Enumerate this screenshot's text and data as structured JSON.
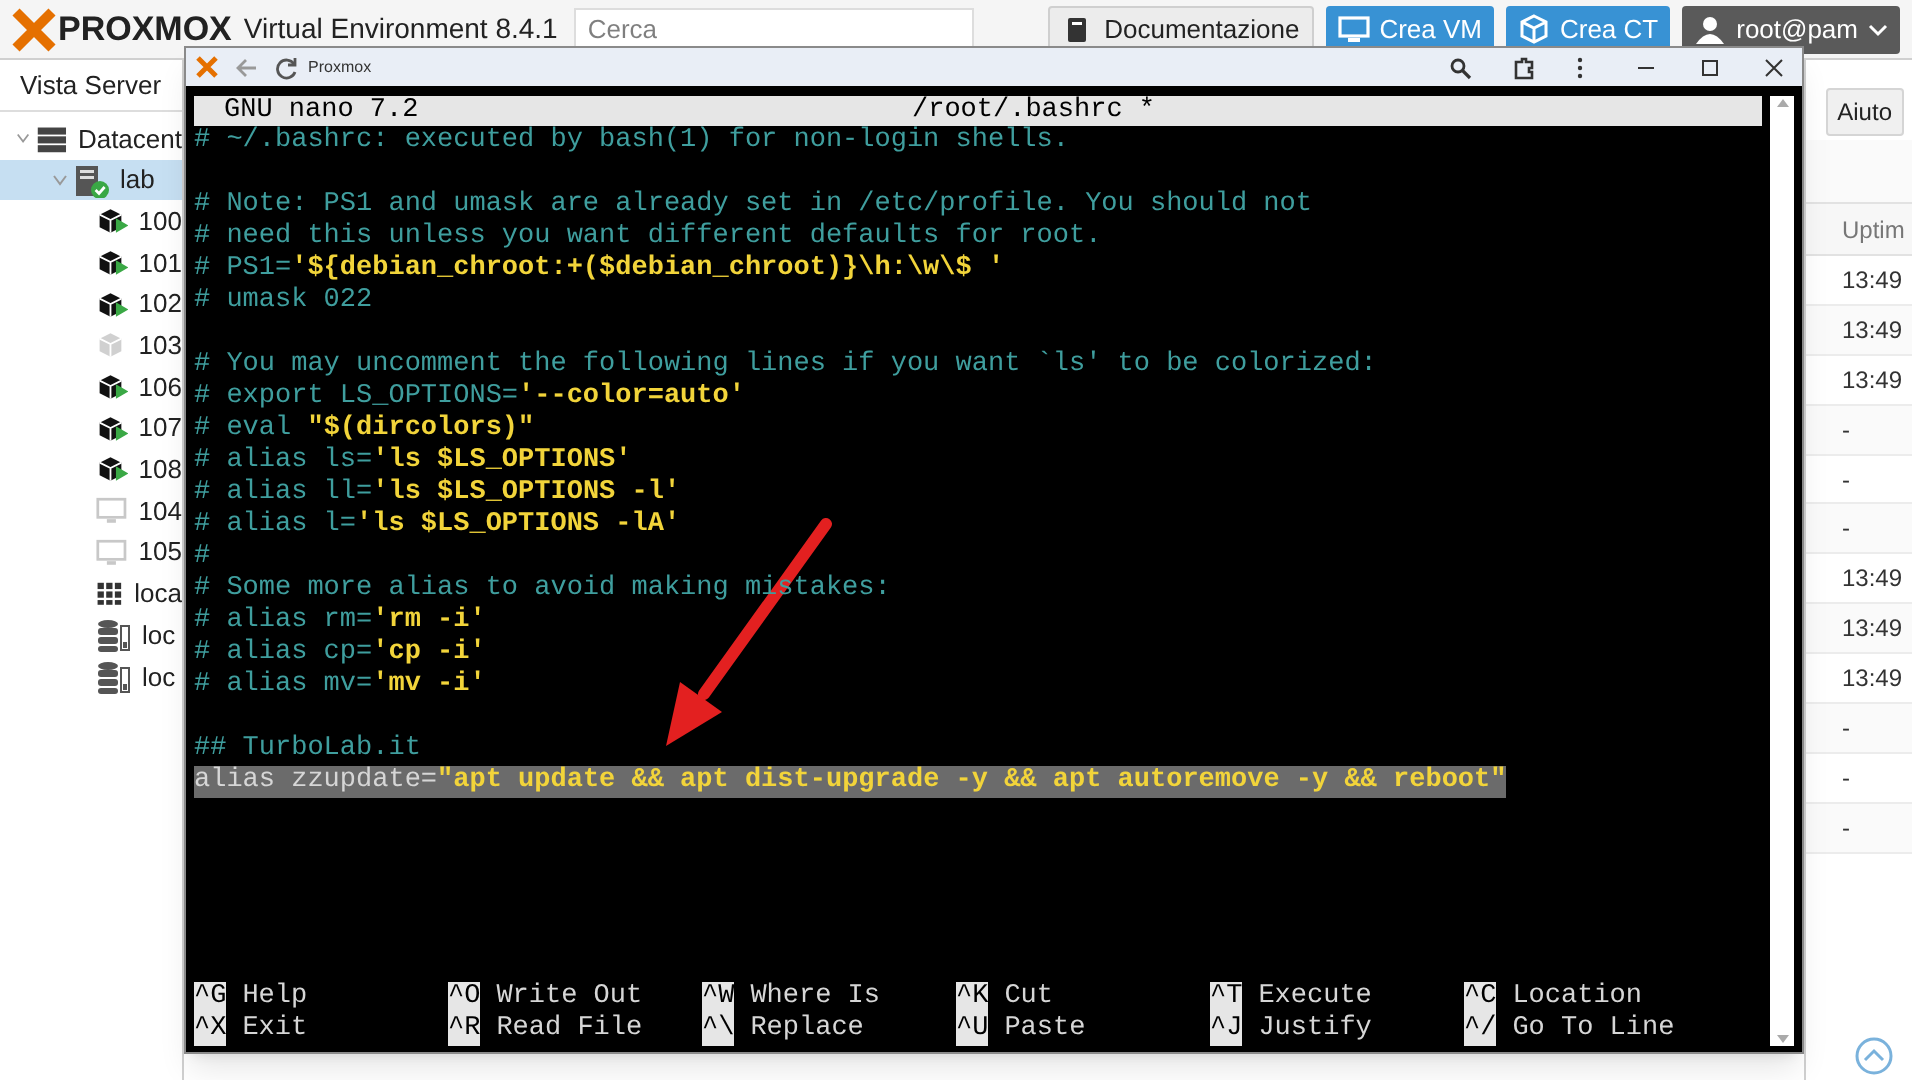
{
  "topbar": {
    "logo": "PROXMOX",
    "product": "Virtual Environment 8.4.1",
    "search": {
      "placeholder": "Cerca"
    },
    "buttons": [
      {
        "label": "Documentazione",
        "kind": "docs"
      },
      {
        "label": "Crea VM",
        "kind": "vm"
      },
      {
        "label": "Crea CT",
        "kind": "ct"
      },
      {
        "label": "root@pam",
        "kind": "user"
      }
    ]
  },
  "sidebar": {
    "view": "Vista Server",
    "tree": [
      {
        "label": "Datacent",
        "kind": "datacenter",
        "expanded": true,
        "selected": false,
        "children": [
          {
            "label": "lab",
            "kind": "node",
            "expanded": true,
            "selected": true,
            "children": [
              {
                "label": "100",
                "kind": "vm",
                "running": true,
                "selected": false
              },
              {
                "label": "101",
                "kind": "vm",
                "running": true,
                "selected": false
              },
              {
                "label": "102",
                "kind": "vm",
                "running": true,
                "selected": false
              },
              {
                "label": "103",
                "kind": "vm",
                "running": false,
                "selected": false
              },
              {
                "label": "106",
                "kind": "vm",
                "running": true,
                "selected": false
              },
              {
                "label": "107",
                "kind": "vm",
                "running": true,
                "selected": false
              },
              {
                "label": "108",
                "kind": "vm",
                "running": true,
                "selected": false
              },
              {
                "label": "104",
                "kind": "template",
                "selected": false
              },
              {
                "label": "105",
                "kind": "template",
                "selected": false
              },
              {
                "label": "loca",
                "kind": "pool",
                "selected": false
              },
              {
                "label": "loc",
                "kind": "storage",
                "selected": false
              },
              {
                "label": "loc",
                "kind": "storage",
                "selected": false
              }
            ]
          }
        ]
      }
    ]
  },
  "right_panel": {
    "help_button": "Aiuto",
    "table": {
      "columns": [
        "Uptim"
      ],
      "rows": [
        {
          "cells": [
            "13:49"
          ]
        },
        {
          "cells": [
            "13:49"
          ]
        },
        {
          "cells": [
            "13:49"
          ]
        },
        {
          "cells": [
            "-"
          ]
        },
        {
          "cells": [
            "-"
          ]
        },
        {
          "cells": [
            "-"
          ]
        },
        {
          "cells": [
            "13:49"
          ]
        },
        {
          "cells": [
            "13:49"
          ]
        },
        {
          "cells": [
            "13:49"
          ]
        },
        {
          "cells": [
            "-"
          ]
        },
        {
          "cells": [
            "-"
          ]
        },
        {
          "cells": [
            "-"
          ]
        }
      ]
    }
  },
  "popup": {
    "title": "Proxmox",
    "editor": {
      "name": "GNU nano 7.2",
      "file": "/root/.bashrc *",
      "lines": [
        {
          "kind": "text",
          "segments": [
            {
              "kind": "comment",
              "text": "# ~/.bashrc: executed by bash(1) for non-login shells."
            }
          ]
        },
        {
          "kind": "blank"
        },
        {
          "kind": "text",
          "segments": [
            {
              "kind": "comment",
              "text": "# Note: PS1 and umask are already set in /etc/profile. You should not"
            }
          ]
        },
        {
          "kind": "text",
          "segments": [
            {
              "kind": "comment",
              "text": "# need this unless you want different defaults for root."
            }
          ]
        },
        {
          "kind": "text",
          "segments": [
            {
              "kind": "comment",
              "text": "# PS1="
            },
            {
              "kind": "string",
              "text": "'${debian_chroot:+($debian_chroot)}\\h:\\w\\$ '"
            }
          ]
        },
        {
          "kind": "text",
          "segments": [
            {
              "kind": "comment",
              "text": "# umask 022"
            }
          ]
        },
        {
          "kind": "blank"
        },
        {
          "kind": "text",
          "segments": [
            {
              "kind": "comment",
              "text": "# You may uncomment the following lines if you want `ls' to be colorized:"
            }
          ]
        },
        {
          "kind": "text",
          "segments": [
            {
              "kind": "comment",
              "text": "# export LS_OPTIONS="
            },
            {
              "kind": "string",
              "text": "'--color=auto'"
            }
          ]
        },
        {
          "kind": "text",
          "segments": [
            {
              "kind": "comment",
              "text": "# eval "
            },
            {
              "kind": "string",
              "text": "\"$(dircolors)\""
            }
          ]
        },
        {
          "kind": "text",
          "segments": [
            {
              "kind": "comment",
              "text": "# alias ls="
            },
            {
              "kind": "string",
              "text": "'ls $LS_OPTIONS'"
            }
          ]
        },
        {
          "kind": "text",
          "segments": [
            {
              "kind": "comment",
              "text": "# alias ll="
            },
            {
              "kind": "string",
              "text": "'ls $LS_OPTIONS -l'"
            }
          ]
        },
        {
          "kind": "text",
          "segments": [
            {
              "kind": "comment",
              "text": "# alias l="
            },
            {
              "kind": "string",
              "text": "'ls $LS_OPTIONS -lA'"
            }
          ]
        },
        {
          "kind": "text",
          "segments": [
            {
              "kind": "comment",
              "text": "#"
            }
          ]
        },
        {
          "kind": "text",
          "segments": [
            {
              "kind": "comment",
              "text": "# Some more alias to avoid making mistakes:"
            }
          ]
        },
        {
          "kind": "text",
          "segments": [
            {
              "kind": "comment",
              "text": "# alias rm="
            },
            {
              "kind": "string",
              "text": "'rm -i'"
            }
          ]
        },
        {
          "kind": "text",
          "segments": [
            {
              "kind": "comment",
              "text": "# alias cp="
            },
            {
              "kind": "string",
              "text": "'cp -i'"
            }
          ]
        },
        {
          "kind": "text",
          "segments": [
            {
              "kind": "comment",
              "text": "# alias mv="
            },
            {
              "kind": "string",
              "text": "'mv -i'"
            }
          ]
        },
        {
          "kind": "blank"
        },
        {
          "kind": "text",
          "segments": [
            {
              "kind": "comment",
              "text": "## TurboLab.it"
            }
          ]
        },
        {
          "kind": "text",
          "highlighted": true,
          "segments": [
            {
              "kind": "plain",
              "text": "alias zzupdate="
            },
            {
              "kind": "string",
              "text": "\"apt update && apt dist-upgrade -y && apt autoremove -y && reboot\""
            }
          ]
        }
      ],
      "shortcuts": [
        [
          {
            "key": "^G",
            "label": "Help"
          },
          {
            "key": "^O",
            "label": "Write Out"
          },
          {
            "key": "^W",
            "label": "Where Is"
          },
          {
            "key": "^K",
            "label": "Cut"
          },
          {
            "key": "^T",
            "label": "Execute"
          },
          {
            "key": "^C",
            "label": "Location"
          }
        ],
        [
          {
            "key": "^X",
            "label": "Exit"
          },
          {
            "key": "^R",
            "label": "Read File"
          },
          {
            "key": "^\\",
            "label": "Replace"
          },
          {
            "key": "^U",
            "label": "Paste"
          },
          {
            "key": "^J",
            "label": "Justify"
          },
          {
            "key": "^/",
            "label": "Go To Line"
          }
        ]
      ]
    }
  }
}
